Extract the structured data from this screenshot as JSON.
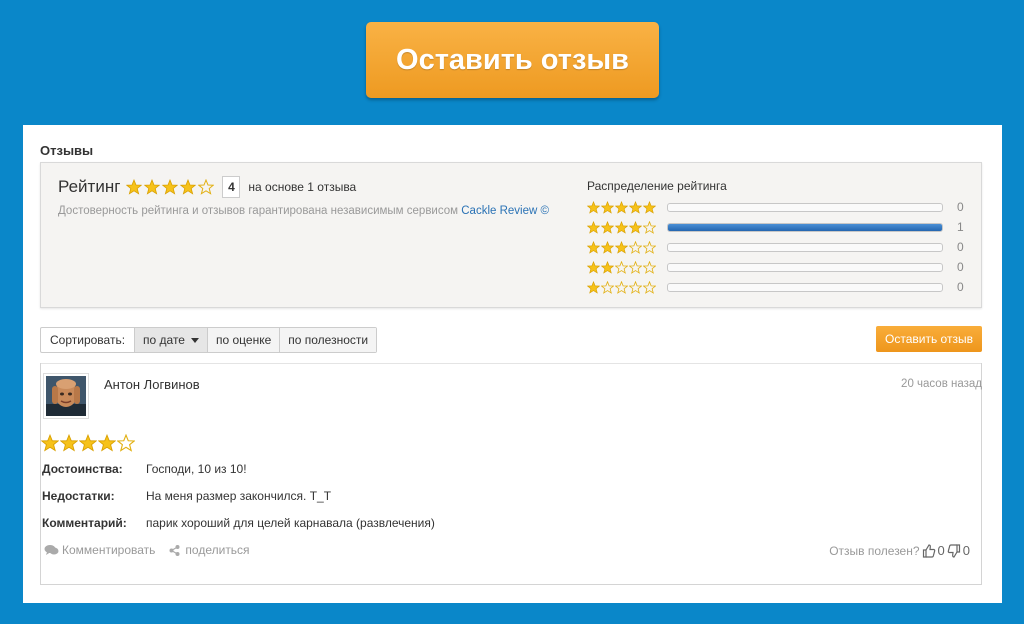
{
  "cta": {
    "label": "Оставить отзыв"
  },
  "section_title": "Отзывы",
  "summary": {
    "rating_label": "Рейтинг",
    "rating_value": "4",
    "rating_stars_filled": 4,
    "based_on": "на основе 1 отзыва",
    "trust_text": "Достоверность рейтинга и отзывов гарантирована независимым сервисом",
    "trust_link": "Cackle Review ©",
    "distribution_title": "Распределение рейтинга",
    "distribution": [
      {
        "stars": 5,
        "count": "0",
        "fraction": 0
      },
      {
        "stars": 4,
        "count": "1",
        "fraction": 1
      },
      {
        "stars": 3,
        "count": "0",
        "fraction": 0
      },
      {
        "stars": 2,
        "count": "0",
        "fraction": 0
      },
      {
        "stars": 1,
        "count": "0",
        "fraction": 0
      }
    ]
  },
  "sort": {
    "label": "Сортировать:",
    "by_date": "по дате",
    "by_rating": "по оценке",
    "by_usefulness": "по полезности"
  },
  "leave_review_small": "Оставить отзыв",
  "review": {
    "author": "Антон Логвинов",
    "time": "20 часов назад",
    "stars_filled": 4,
    "pros_label": "Достоинства:",
    "pros": "Господи, 10 из 10!",
    "cons_label": "Недостатки:",
    "cons": "На меня размер закончился. T_T",
    "comment_label": "Комментарий:",
    "comment": "парик хороший для целей карнавала (развлечения)",
    "action_comment": "Комментировать",
    "action_share": "поделиться",
    "helpful_label": "Отзыв полезен?",
    "likes": "0",
    "dislikes": "0"
  },
  "colors": {
    "background": "#0a87c9",
    "accent_orange": "#f3a532",
    "star_fill": "#f6c21a",
    "bar_fill": "#2f72bd",
    "link": "#2a72b5"
  }
}
